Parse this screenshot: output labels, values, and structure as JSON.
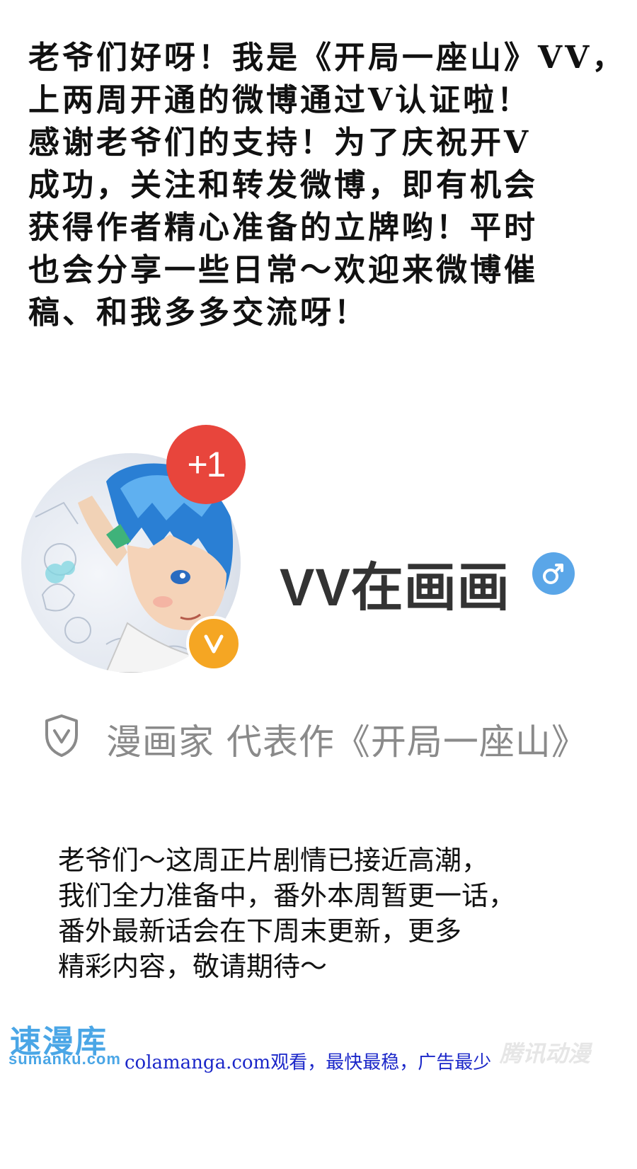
{
  "intro": {
    "lines": [
      "老爷们好呀！我是《开局一座山》VV，",
      "上两周开通的微博通过V认证啦！",
      "感谢老爷们的支持！为了庆祝开V",
      "成功，关注和转发微博，即有机会",
      "获得作者精心准备的立牌哟！平时",
      "也会分享一些日常～欢迎来微博催",
      "稿、和我多多交流呀！"
    ]
  },
  "profile": {
    "notification_count": "+1",
    "verified_mark": "V",
    "name": "VV在画画",
    "gender_icon": "male-icon",
    "accent_colors": {
      "badge": "#e8453c",
      "verified": "#f5a623",
      "gender": "#5aa6e8"
    }
  },
  "verification": {
    "icon": "shield-check-icon",
    "text": "漫画家 代表作《开局一座山》"
  },
  "notice": {
    "lines": [
      "老爷们～这周正片剧情已接近高潮，",
      "我们全力准备中，番外本周暂更一话，",
      "番外最新话会在下周末更新，更多",
      "精彩内容，敬请期待～"
    ]
  },
  "watermarks": {
    "logo": "速漫库",
    "logo_sub": "sumanku.com",
    "site_text": "colamanga.com观看，最快最稳，广告最少",
    "right_logo": "腾讯动漫"
  }
}
